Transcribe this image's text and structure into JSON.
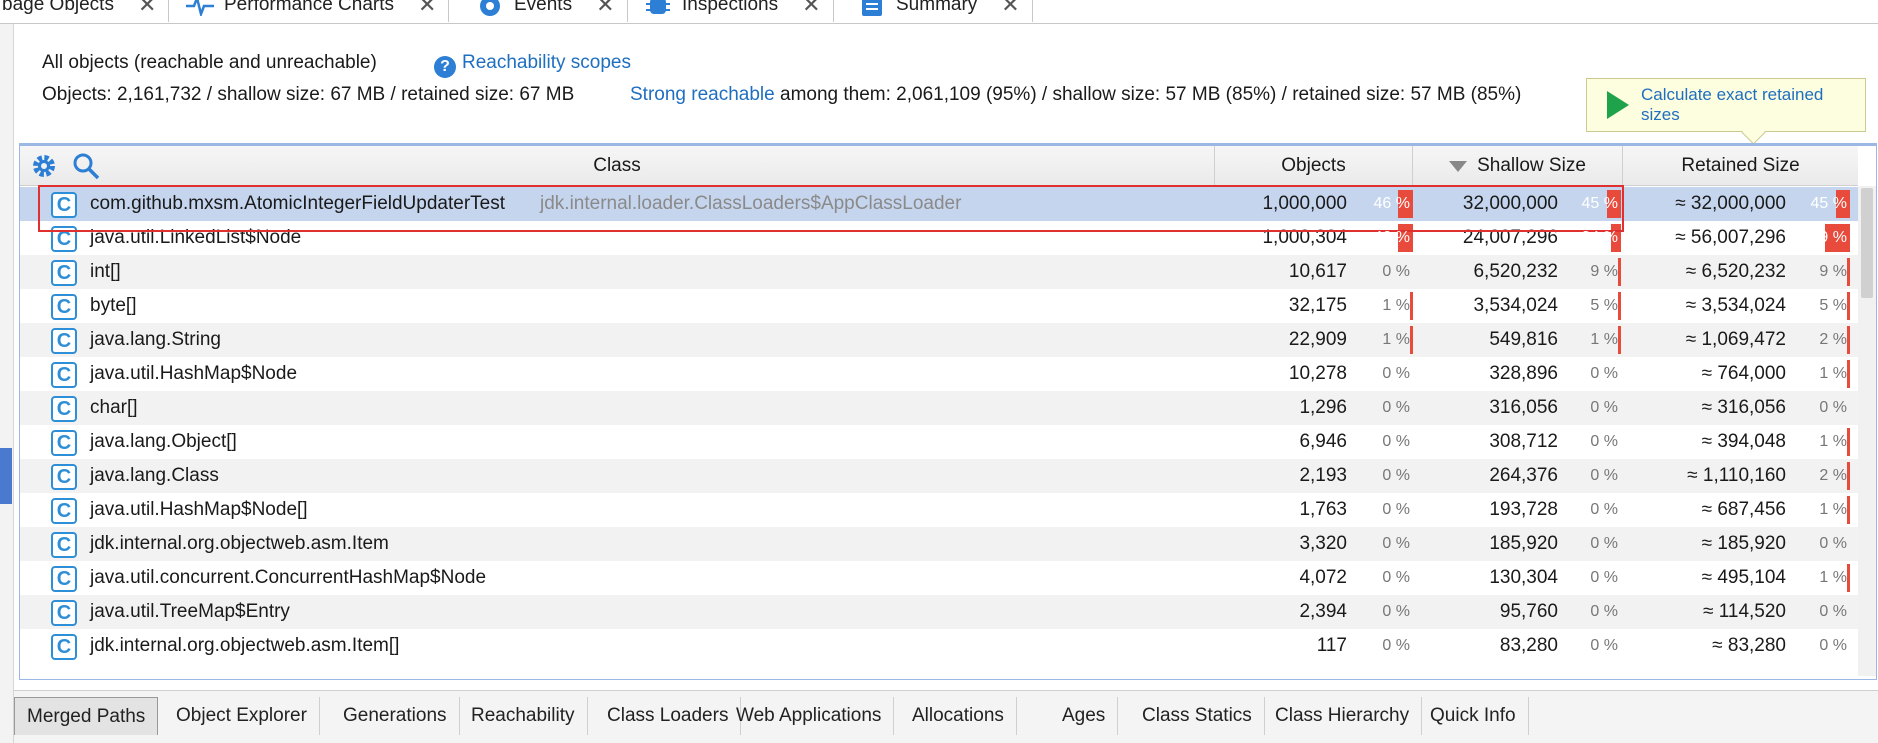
{
  "top_tabs": [
    {
      "label": "bage Objects",
      "icon": "none"
    },
    {
      "label": "Performance Charts",
      "icon": "pulse-icon"
    },
    {
      "label": "Events",
      "icon": "eye-icon"
    },
    {
      "label": "Inspections",
      "icon": "bug-icon"
    },
    {
      "label": "Summary",
      "icon": "document-icon"
    }
  ],
  "info": {
    "title": "All objects (reachable and unreachable)",
    "reachability_link": "Reachability scopes",
    "stats": "Objects: 2,161,732 / shallow size: 67 MB / retained size: 67 MB",
    "strong_link": "Strong reachable",
    "strong_stats": " among them: 2,061,109 (95%) / shallow size: 57 MB (85%) / retained size: 57 MB (85%)"
  },
  "calculate_button": "Calculate exact retained sizes",
  "columns": {
    "class": "Class",
    "objects": "Objects",
    "shallow": "Shallow Size",
    "retained": "Retained Size"
  },
  "rows": [
    {
      "name": "com.github.mxsm.AtomicIntegerFieldUpdaterTest",
      "loader": "jdk.internal.loader.ClassLoaders$AppClassLoader",
      "objects": "1,000,000",
      "objects_pct": "46 %",
      "objects_frac": 0.46,
      "shallow": "32,000,000",
      "shallow_pct": "45 %",
      "shallow_frac": 0.45,
      "retained": "≈ 32,000,000",
      "retained_pct": "45 %",
      "retained_frac": 0.45
    },
    {
      "name": "java.util.LinkedList$Node",
      "loader": "",
      "objects": "1,000,304",
      "objects_pct": "46 %",
      "objects_frac": 0.46,
      "shallow": "24,007,296",
      "shallow_pct": "34 %",
      "shallow_frac": 0.34,
      "retained": "≈ 56,007,296",
      "retained_pct": "79 %",
      "retained_frac": 0.79
    },
    {
      "name": "int[]",
      "loader": "",
      "objects": "10,617",
      "objects_pct": "0 %",
      "objects_frac": 0,
      "shallow": "6,520,232",
      "shallow_pct": "9 %",
      "shallow_frac": 0.09,
      "retained": "≈ 6,520,232",
      "retained_pct": "9 %",
      "retained_frac": 0.09
    },
    {
      "name": "byte[]",
      "loader": "",
      "objects": "32,175",
      "objects_pct": "1 %",
      "objects_frac": 0.01,
      "shallow": "3,534,024",
      "shallow_pct": "5 %",
      "shallow_frac": 0.05,
      "retained": "≈ 3,534,024",
      "retained_pct": "5 %",
      "retained_frac": 0.05
    },
    {
      "name": "java.lang.String",
      "loader": "",
      "objects": "22,909",
      "objects_pct": "1 %",
      "objects_frac": 0.01,
      "shallow": "549,816",
      "shallow_pct": "1 %",
      "shallow_frac": 0.01,
      "retained": "≈ 1,069,472",
      "retained_pct": "2 %",
      "retained_frac": 0.02
    },
    {
      "name": "java.util.HashMap$Node",
      "loader": "",
      "objects": "10,278",
      "objects_pct": "0 %",
      "objects_frac": 0,
      "shallow": "328,896",
      "shallow_pct": "0 %",
      "shallow_frac": 0,
      "retained": "≈ 764,000",
      "retained_pct": "1 %",
      "retained_frac": 0.01
    },
    {
      "name": "char[]",
      "loader": "",
      "objects": "1,296",
      "objects_pct": "0 %",
      "objects_frac": 0,
      "shallow": "316,056",
      "shallow_pct": "0 %",
      "shallow_frac": 0,
      "retained": "≈ 316,056",
      "retained_pct": "0 %",
      "retained_frac": 0
    },
    {
      "name": "java.lang.Object[]",
      "loader": "",
      "objects": "6,946",
      "objects_pct": "0 %",
      "objects_frac": 0,
      "shallow": "308,712",
      "shallow_pct": "0 %",
      "shallow_frac": 0,
      "retained": "≈ 394,048",
      "retained_pct": "1 %",
      "retained_frac": 0.01
    },
    {
      "name": "java.lang.Class",
      "loader": "",
      "objects": "2,193",
      "objects_pct": "0 %",
      "objects_frac": 0,
      "shallow": "264,376",
      "shallow_pct": "0 %",
      "shallow_frac": 0,
      "retained": "≈ 1,110,160",
      "retained_pct": "2 %",
      "retained_frac": 0.02
    },
    {
      "name": "java.util.HashMap$Node[]",
      "loader": "",
      "objects": "1,763",
      "objects_pct": "0 %",
      "objects_frac": 0,
      "shallow": "193,728",
      "shallow_pct": "0 %",
      "shallow_frac": 0,
      "retained": "≈ 687,456",
      "retained_pct": "1 %",
      "retained_frac": 0.01
    },
    {
      "name": "jdk.internal.org.objectweb.asm.Item",
      "loader": "",
      "objects": "3,320",
      "objects_pct": "0 %",
      "objects_frac": 0,
      "shallow": "185,920",
      "shallow_pct": "0 %",
      "shallow_frac": 0,
      "retained": "≈ 185,920",
      "retained_pct": "0 %",
      "retained_frac": 0
    },
    {
      "name": "java.util.concurrent.ConcurrentHashMap$Node",
      "loader": "",
      "objects": "4,072",
      "objects_pct": "0 %",
      "objects_frac": 0,
      "shallow": "130,304",
      "shallow_pct": "0 %",
      "shallow_frac": 0,
      "retained": "≈ 495,104",
      "retained_pct": "1 %",
      "retained_frac": 0.01
    },
    {
      "name": "java.util.TreeMap$Entry",
      "loader": "",
      "objects": "2,394",
      "objects_pct": "0 %",
      "objects_frac": 0,
      "shallow": "95,760",
      "shallow_pct": "0 %",
      "shallow_frac": 0,
      "retained": "≈ 114,520",
      "retained_pct": "0 %",
      "retained_frac": 0
    },
    {
      "name": "jdk.internal.org.objectweb.asm.Item[]",
      "loader": "",
      "objects": "117",
      "objects_pct": "0 %",
      "objects_frac": 0,
      "shallow": "83,280",
      "shallow_pct": "0 %",
      "shallow_frac": 0,
      "retained": "≈ 83,280",
      "retained_pct": "0 %",
      "retained_frac": 0
    }
  ],
  "bottom_tabs": [
    "Merged Paths",
    "Object Explorer",
    "Generations",
    "Reachability",
    "Class Loaders",
    "Web Applications",
    "Allocations",
    "Ages",
    "Class Statics",
    "Class Hierarchy",
    "Quick Info"
  ],
  "class_icon_letter": "C",
  "colors": {
    "accent": "#1f6fc0",
    "bar": "#e84a3c",
    "selection": "#c5d5ee",
    "highlight": "#e03030"
  }
}
